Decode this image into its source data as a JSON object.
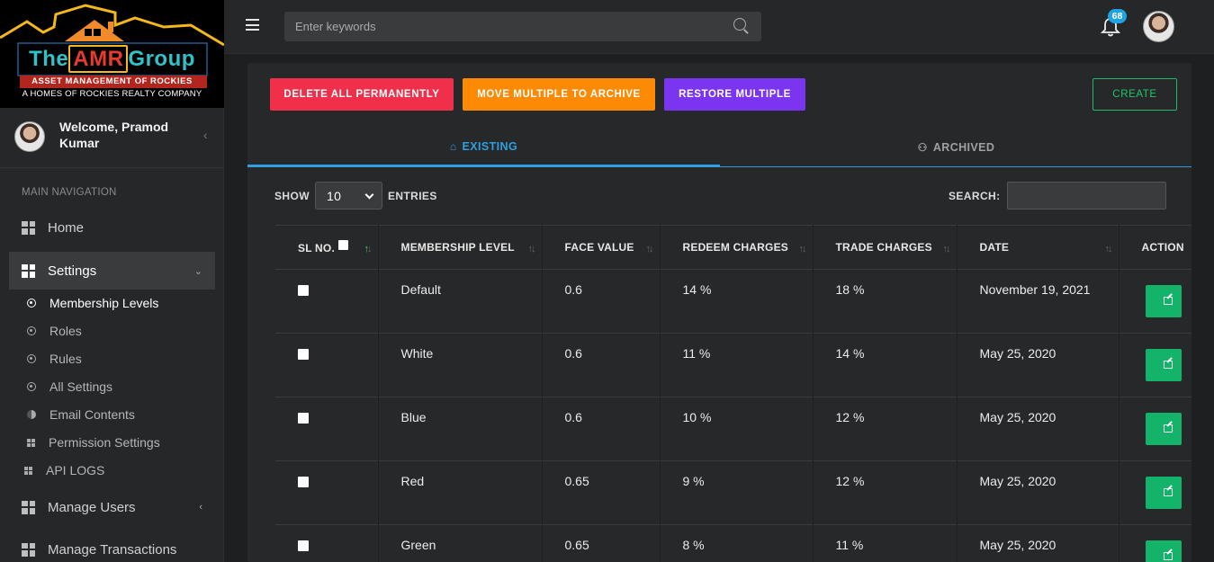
{
  "brand": {
    "name_pre": "The",
    "name_amr": "AMR",
    "name_post": "Group",
    "tagline": "ASSET MANAGEMENT OF ROCKIES",
    "subline": "A HOMES OF ROCKIES REALTY COMPANY"
  },
  "user": {
    "welcome": "Welcome, Pramod Kumar"
  },
  "nav": {
    "header": "MAIN NAVIGATION",
    "home": "Home",
    "settings": "Settings",
    "settings_items": [
      "Membership Levels",
      "Roles",
      "Rules",
      "All Settings",
      "Email Contents",
      "Permission Settings",
      "API LOGS"
    ],
    "manage_users": "Manage Users",
    "manage_transactions": "Manage Transactions"
  },
  "topbar": {
    "search_placeholder": "Enter keywords",
    "notification_count": "68"
  },
  "actions": {
    "delete_all": "DELETE ALL PERMANENTLY",
    "move_archive": "MOVE MULTIPLE TO ARCHIVE",
    "restore": "RESTORE MULTIPLE",
    "create": "CREATE"
  },
  "tabs": {
    "existing": "EXISTING",
    "archived": "ARCHIVED"
  },
  "table_controls": {
    "show": "SHOW",
    "entries_value": "10",
    "entries": "ENTRIES",
    "search": "SEARCH:"
  },
  "table": {
    "headers": [
      "SL NO.",
      "MEMBERSHIP LEVEL",
      "FACE VALUE",
      "REDEEM CHARGES",
      "TRADE CHARGES",
      "DATE",
      "ACTION"
    ],
    "rows": [
      {
        "level": "Default",
        "face": "0.6",
        "redeem": "14 %",
        "trade": "18 %",
        "date": "November 19, 2021"
      },
      {
        "level": "White",
        "face": "0.6",
        "redeem": "11 %",
        "trade": "14 %",
        "date": "May 25, 2020"
      },
      {
        "level": "Blue",
        "face": "0.6",
        "redeem": "10 %",
        "trade": "12 %",
        "date": "May 25, 2020"
      },
      {
        "level": "Red",
        "face": "0.65",
        "redeem": "9 %",
        "trade": "12 %",
        "date": "May 25, 2020"
      },
      {
        "level": "Green",
        "face": "0.65",
        "redeem": "8 %",
        "trade": "11 %",
        "date": "May 25, 2020"
      }
    ]
  },
  "colors": {
    "delete": "#f0304a",
    "archive": "#fd8a05",
    "restore": "#7b35f0",
    "create": "#21c56e",
    "tab_active": "#2e9fe0",
    "edit": "#14b36a"
  }
}
